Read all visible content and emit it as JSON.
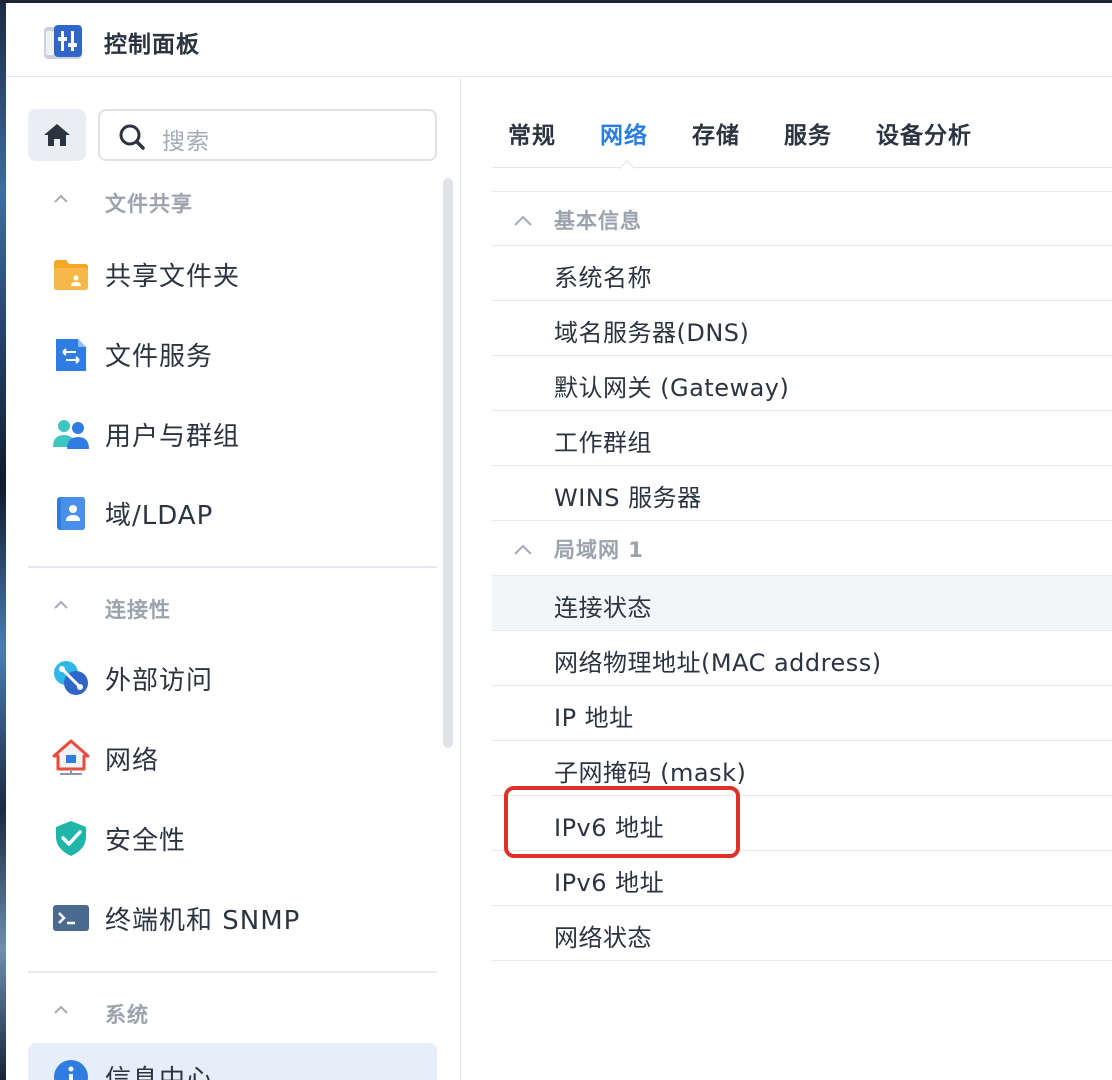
{
  "window": {
    "title": "控制面板"
  },
  "sidebar": {
    "search": {
      "placeholder": "搜索"
    },
    "sections": [
      {
        "title": "文件共享",
        "items": [
          {
            "label": "共享文件夹",
            "icon": "shared-folder-icon"
          },
          {
            "label": "文件服务",
            "icon": "file-services-icon"
          },
          {
            "label": "用户与群组",
            "icon": "users-groups-icon"
          },
          {
            "label": "域/LDAP",
            "icon": "domain-ldap-icon"
          }
        ]
      },
      {
        "title": "连接性",
        "items": [
          {
            "label": "外部访问",
            "icon": "external-access-icon"
          },
          {
            "label": "网络",
            "icon": "network-icon"
          },
          {
            "label": "安全性",
            "icon": "security-shield-icon"
          },
          {
            "label": "终端机和 SNMP",
            "icon": "terminal-icon"
          }
        ]
      },
      {
        "title": "系统",
        "items": [
          {
            "label": "信息中心",
            "icon": "info-center-icon",
            "selected": true
          }
        ]
      }
    ]
  },
  "main": {
    "tabs": [
      {
        "label": "常规"
      },
      {
        "label": "网络",
        "active": true
      },
      {
        "label": "存储"
      },
      {
        "label": "服务"
      },
      {
        "label": "设备分析"
      }
    ],
    "groups": [
      {
        "title": "基本信息",
        "rows": [
          "系统名称",
          "域名服务器(DNS)",
          "默认网关 (Gateway)",
          "工作群组",
          "WINS 服务器"
        ]
      },
      {
        "title": "局域网 1",
        "rows": [
          "连接状态",
          "网络物理地址(MAC address)",
          "IP 地址",
          "子网掩码 (mask)",
          "IPv6 地址",
          "IPv6 地址",
          "网络状态"
        ]
      }
    ]
  },
  "colors": {
    "accent": "#2a7de1",
    "highlight": "#e0302a",
    "selected_bg": "#e6eef9"
  }
}
